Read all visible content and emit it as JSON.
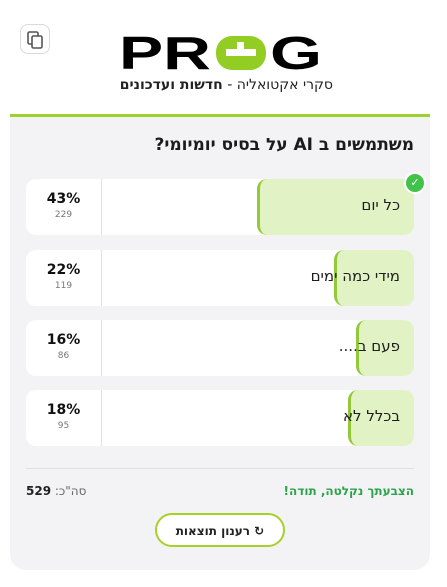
{
  "header": {
    "brand_left": "PR",
    "brand_right": "G",
    "tagline_prefix": "סקרי אקטואליה - ",
    "tagline_bold": "חדשות ועדכונים"
  },
  "poll": {
    "question": "משתמשים ב AI על בסיס יומיומי?",
    "options": [
      {
        "label": "כל יום",
        "percent": "43%",
        "votes": "229",
        "fraction": 0.43,
        "selected": true
      },
      {
        "label": "מידי כמה ימים",
        "percent": "22%",
        "votes": "119",
        "fraction": 0.22,
        "selected": false
      },
      {
        "label": "פעם ב....",
        "percent": "16%",
        "votes": "86",
        "fraction": 0.16,
        "selected": false
      },
      {
        "label": "בכלל לא",
        "percent": "18%",
        "votes": "95",
        "fraction": 0.18,
        "selected": false
      }
    ]
  },
  "footer": {
    "thanks": "הצבעתך נקלטה, תודה!",
    "total_label": "סה\"כ:",
    "total_value": "529",
    "refresh_label": "↻ רענון תוצאות"
  },
  "icons": {
    "copy": "copy-icon",
    "check": "check-icon"
  },
  "colors": {
    "accent": "#9dd12e",
    "fill": "#e1f3c4",
    "success": "#2aa34a",
    "check": "#41c24a"
  }
}
